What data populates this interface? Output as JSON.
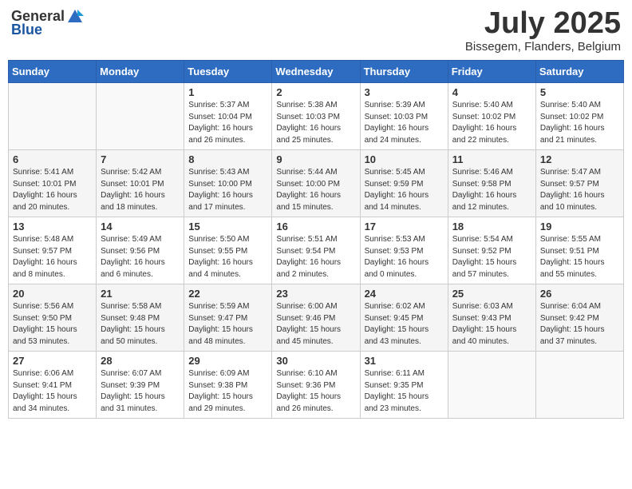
{
  "header": {
    "logo_general": "General",
    "logo_blue": "Blue",
    "month_title": "July 2025",
    "location": "Bissegem, Flanders, Belgium"
  },
  "weekdays": [
    "Sunday",
    "Monday",
    "Tuesday",
    "Wednesday",
    "Thursday",
    "Friday",
    "Saturday"
  ],
  "weeks": [
    [
      {
        "day": "",
        "info": ""
      },
      {
        "day": "",
        "info": ""
      },
      {
        "day": "1",
        "info": "Sunrise: 5:37 AM\nSunset: 10:04 PM\nDaylight: 16 hours\nand 26 minutes."
      },
      {
        "day": "2",
        "info": "Sunrise: 5:38 AM\nSunset: 10:03 PM\nDaylight: 16 hours\nand 25 minutes."
      },
      {
        "day": "3",
        "info": "Sunrise: 5:39 AM\nSunset: 10:03 PM\nDaylight: 16 hours\nand 24 minutes."
      },
      {
        "day": "4",
        "info": "Sunrise: 5:40 AM\nSunset: 10:02 PM\nDaylight: 16 hours\nand 22 minutes."
      },
      {
        "day": "5",
        "info": "Sunrise: 5:40 AM\nSunset: 10:02 PM\nDaylight: 16 hours\nand 21 minutes."
      }
    ],
    [
      {
        "day": "6",
        "info": "Sunrise: 5:41 AM\nSunset: 10:01 PM\nDaylight: 16 hours\nand 20 minutes."
      },
      {
        "day": "7",
        "info": "Sunrise: 5:42 AM\nSunset: 10:01 PM\nDaylight: 16 hours\nand 18 minutes."
      },
      {
        "day": "8",
        "info": "Sunrise: 5:43 AM\nSunset: 10:00 PM\nDaylight: 16 hours\nand 17 minutes."
      },
      {
        "day": "9",
        "info": "Sunrise: 5:44 AM\nSunset: 10:00 PM\nDaylight: 16 hours\nand 15 minutes."
      },
      {
        "day": "10",
        "info": "Sunrise: 5:45 AM\nSunset: 9:59 PM\nDaylight: 16 hours\nand 14 minutes."
      },
      {
        "day": "11",
        "info": "Sunrise: 5:46 AM\nSunset: 9:58 PM\nDaylight: 16 hours\nand 12 minutes."
      },
      {
        "day": "12",
        "info": "Sunrise: 5:47 AM\nSunset: 9:57 PM\nDaylight: 16 hours\nand 10 minutes."
      }
    ],
    [
      {
        "day": "13",
        "info": "Sunrise: 5:48 AM\nSunset: 9:57 PM\nDaylight: 16 hours\nand 8 minutes."
      },
      {
        "day": "14",
        "info": "Sunrise: 5:49 AM\nSunset: 9:56 PM\nDaylight: 16 hours\nand 6 minutes."
      },
      {
        "day": "15",
        "info": "Sunrise: 5:50 AM\nSunset: 9:55 PM\nDaylight: 16 hours\nand 4 minutes."
      },
      {
        "day": "16",
        "info": "Sunrise: 5:51 AM\nSunset: 9:54 PM\nDaylight: 16 hours\nand 2 minutes."
      },
      {
        "day": "17",
        "info": "Sunrise: 5:53 AM\nSunset: 9:53 PM\nDaylight: 16 hours\nand 0 minutes."
      },
      {
        "day": "18",
        "info": "Sunrise: 5:54 AM\nSunset: 9:52 PM\nDaylight: 15 hours\nand 57 minutes."
      },
      {
        "day": "19",
        "info": "Sunrise: 5:55 AM\nSunset: 9:51 PM\nDaylight: 15 hours\nand 55 minutes."
      }
    ],
    [
      {
        "day": "20",
        "info": "Sunrise: 5:56 AM\nSunset: 9:50 PM\nDaylight: 15 hours\nand 53 minutes."
      },
      {
        "day": "21",
        "info": "Sunrise: 5:58 AM\nSunset: 9:48 PM\nDaylight: 15 hours\nand 50 minutes."
      },
      {
        "day": "22",
        "info": "Sunrise: 5:59 AM\nSunset: 9:47 PM\nDaylight: 15 hours\nand 48 minutes."
      },
      {
        "day": "23",
        "info": "Sunrise: 6:00 AM\nSunset: 9:46 PM\nDaylight: 15 hours\nand 45 minutes."
      },
      {
        "day": "24",
        "info": "Sunrise: 6:02 AM\nSunset: 9:45 PM\nDaylight: 15 hours\nand 43 minutes."
      },
      {
        "day": "25",
        "info": "Sunrise: 6:03 AM\nSunset: 9:43 PM\nDaylight: 15 hours\nand 40 minutes."
      },
      {
        "day": "26",
        "info": "Sunrise: 6:04 AM\nSunset: 9:42 PM\nDaylight: 15 hours\nand 37 minutes."
      }
    ],
    [
      {
        "day": "27",
        "info": "Sunrise: 6:06 AM\nSunset: 9:41 PM\nDaylight: 15 hours\nand 34 minutes."
      },
      {
        "day": "28",
        "info": "Sunrise: 6:07 AM\nSunset: 9:39 PM\nDaylight: 15 hours\nand 31 minutes."
      },
      {
        "day": "29",
        "info": "Sunrise: 6:09 AM\nSunset: 9:38 PM\nDaylight: 15 hours\nand 29 minutes."
      },
      {
        "day": "30",
        "info": "Sunrise: 6:10 AM\nSunset: 9:36 PM\nDaylight: 15 hours\nand 26 minutes."
      },
      {
        "day": "31",
        "info": "Sunrise: 6:11 AM\nSunset: 9:35 PM\nDaylight: 15 hours\nand 23 minutes."
      },
      {
        "day": "",
        "info": ""
      },
      {
        "day": "",
        "info": ""
      }
    ]
  ]
}
